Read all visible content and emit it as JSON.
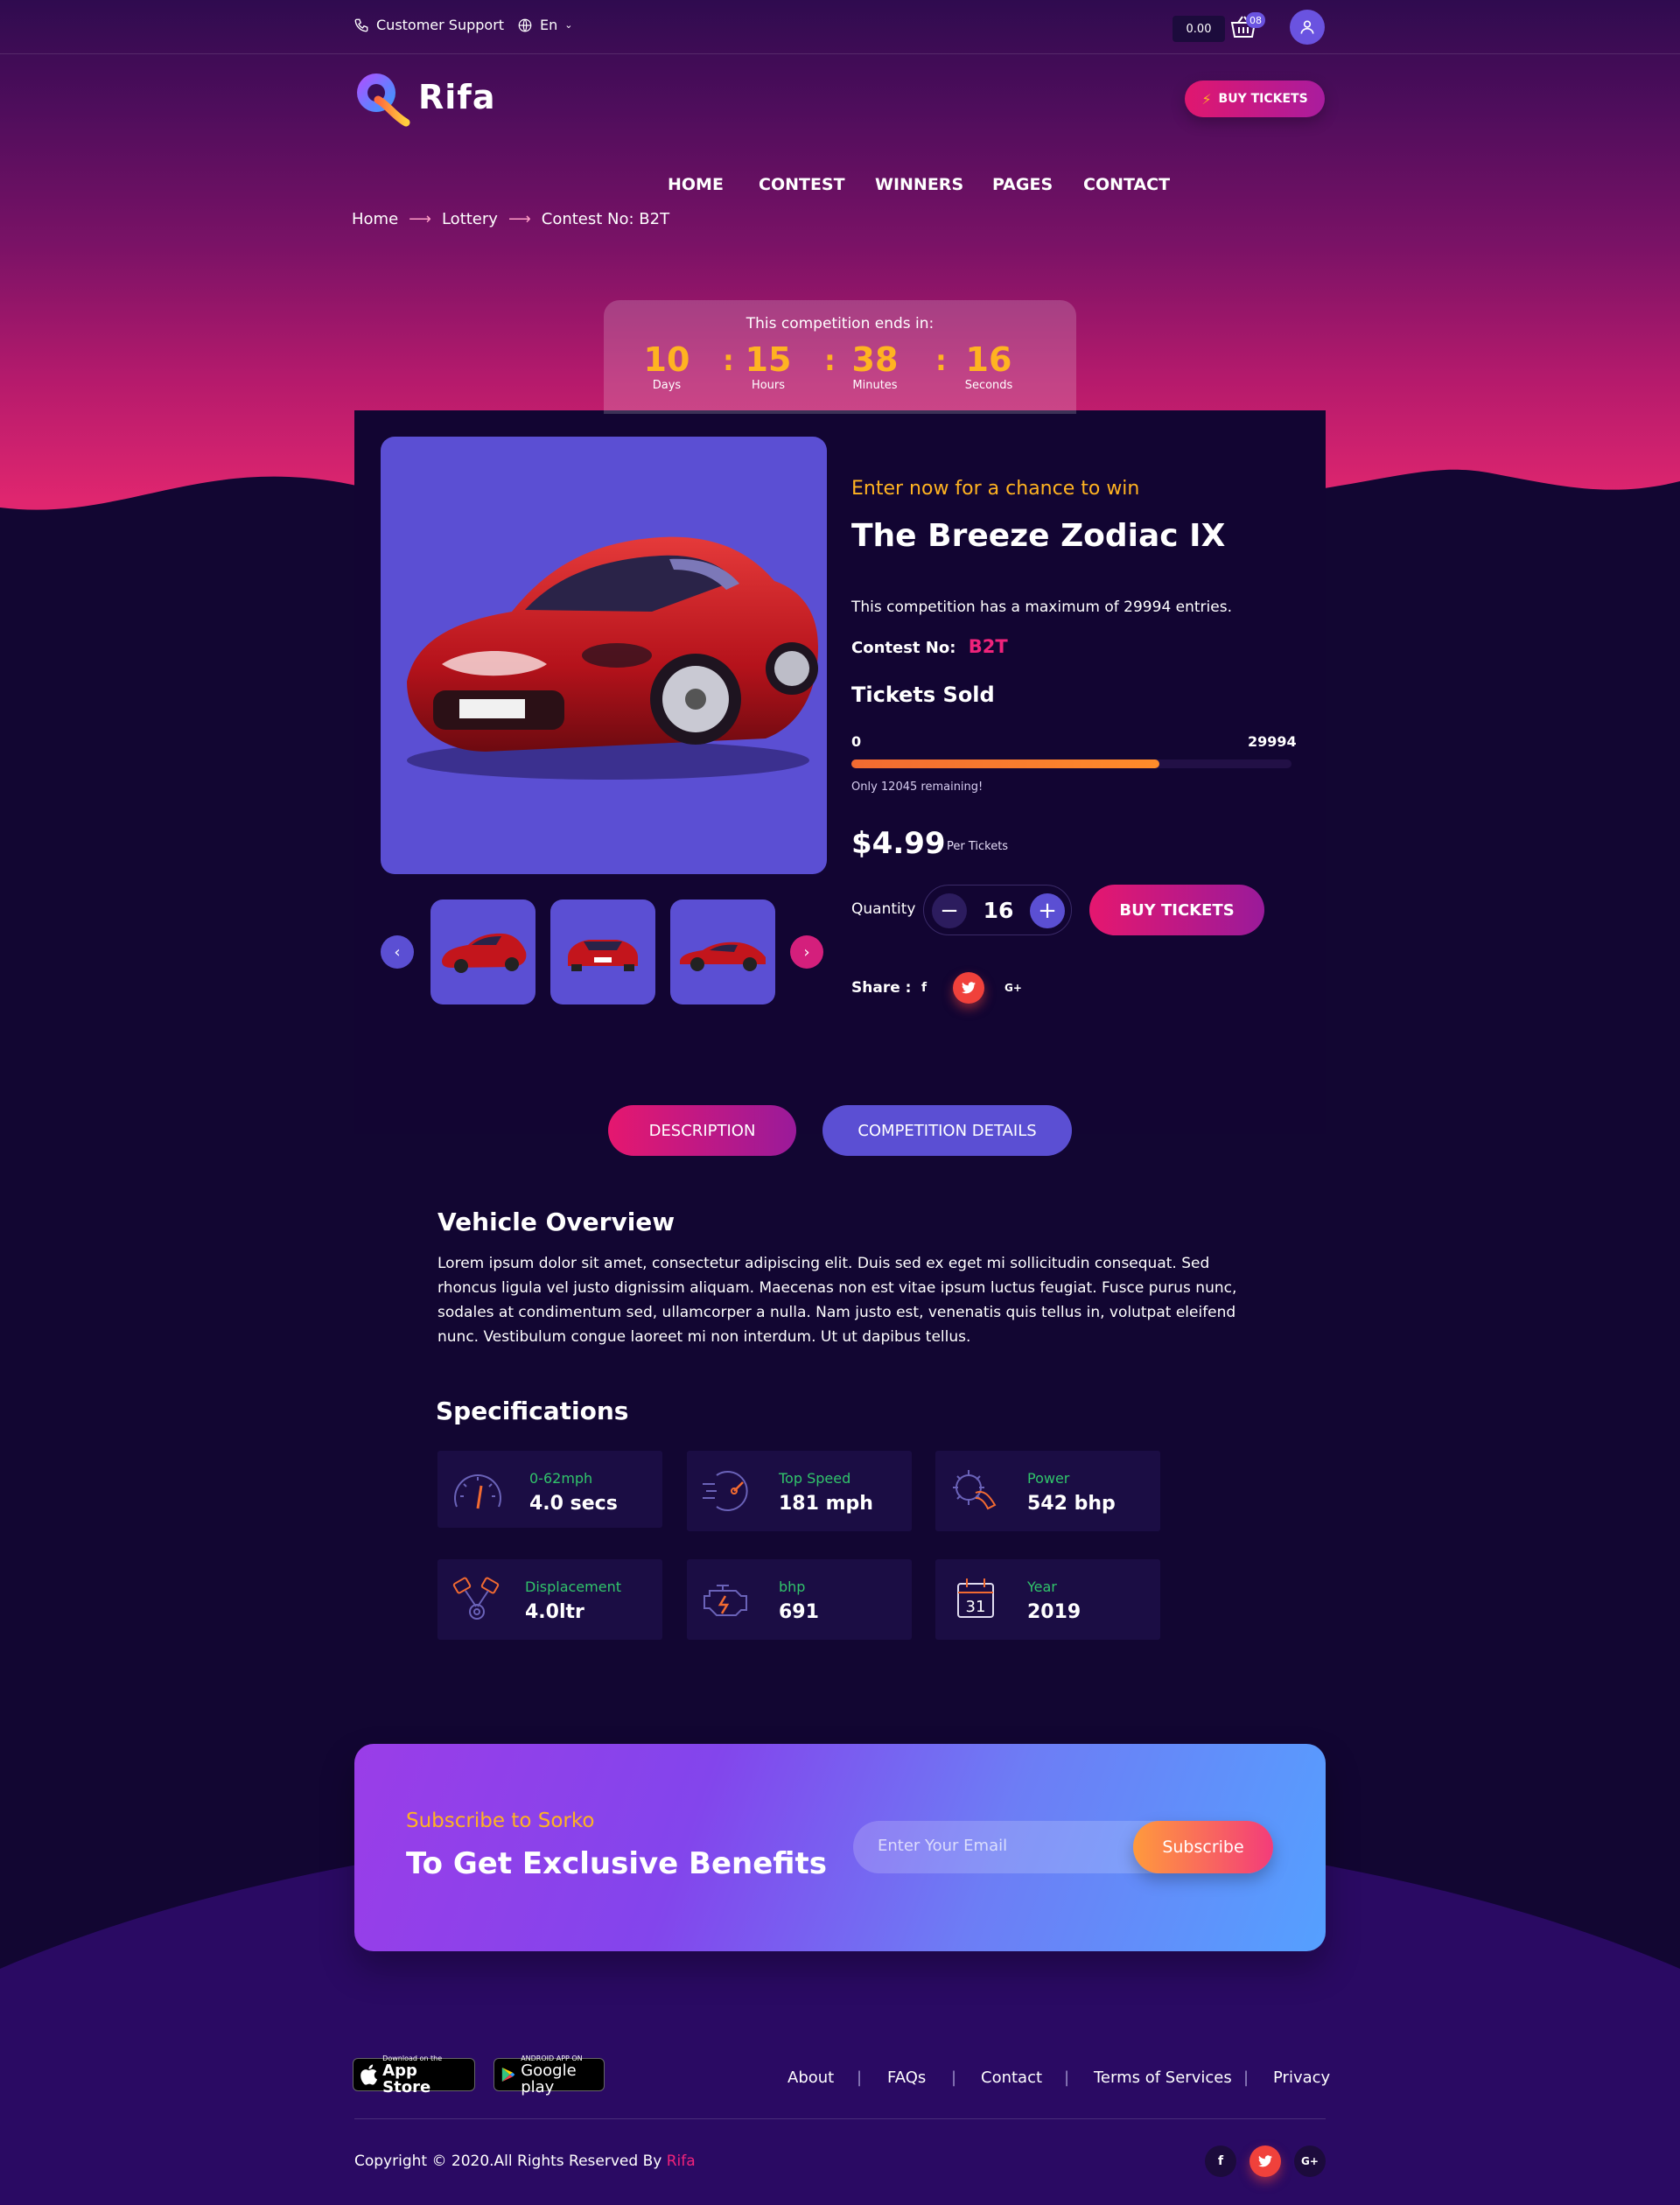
{
  "topbar": {
    "support_label": "Customer Support",
    "language": "En",
    "cart_amount": "0.00",
    "cart_count": "08"
  },
  "brand": {
    "name": "Rifa"
  },
  "nav": {
    "items": [
      "HOME",
      "CONTEST",
      "WINNERS",
      "PAGES",
      "CONTACT"
    ],
    "buy_label": "BUY TICKETS"
  },
  "breadcrumb": [
    "Home",
    "Lottery",
    "Contest No: B2T"
  ],
  "countdown": {
    "title": "This competition ends in:",
    "units": [
      {
        "value": "10",
        "label": "Days"
      },
      {
        "value": "15",
        "label": "Hours"
      },
      {
        "value": "38",
        "label": "Minutes"
      },
      {
        "value": "16",
        "label": "Seconds"
      }
    ]
  },
  "product": {
    "subtitle": "Enter now for a chance to win",
    "title": "The Breeze Zodiac IX",
    "max_entries": "This competition has a maximum of 29994 entries.",
    "contest_label": "Contest No:",
    "contest_value": "B2T",
    "tickets_sold_label": "Tickets Sold",
    "progress_min": "0",
    "progress_max": "29994",
    "progress_fraction": 0.7,
    "remaining": "Only 12045 remaining!",
    "price": "$4.99",
    "price_unit": "Per Tickets",
    "quantity_label": "Quantity",
    "quantity": "16",
    "buy_label": "BUY TICKETS",
    "share_label": "Share :",
    "share_icons": [
      "facebook-icon",
      "twitter-icon",
      "google-plus-icon"
    ]
  },
  "tabs": [
    "DESCRIPTION",
    "COMPETITION DETAILS"
  ],
  "overview": {
    "title": "Vehicle Overview",
    "text": "Lorem ipsum dolor sit amet, consectetur adipiscing elit. Duis sed ex eget mi sollicitudin consequat. Sed rhoncus ligula vel justo dignissim aliquam. Maecenas non est vitae ipsum luctus feugiat. Fusce purus nunc, sodales at condimentum sed, ullamcorper a nulla. Nam justo est, venenatis quis tellus in, volutpat eleifend nunc. Vestibulum congue laoreet mi non interdum. Ut ut dapibus tellus."
  },
  "specs": {
    "title": "Specifications",
    "items": [
      {
        "label": "0-62mph",
        "value": "4.0 secs",
        "icon": "speedometer-icon"
      },
      {
        "label": "Top Speed",
        "value": "181 mph",
        "icon": "speed-gauge-icon"
      },
      {
        "label": "Power",
        "value": "542 bhp",
        "icon": "power-icon"
      },
      {
        "label": "Displacement",
        "value": "4.0ltr",
        "icon": "pistons-icon"
      },
      {
        "label": "bhp",
        "value": "691",
        "icon": "engine-icon"
      },
      {
        "label": "Year",
        "value": "2019",
        "icon": "calendar-icon",
        "icon_text": "31"
      }
    ]
  },
  "subscribe": {
    "kicker": "Subscribe to Sorko",
    "heading": "To Get Exclusive Benefits",
    "placeholder": "Enter Your Email",
    "button": "Subscribe"
  },
  "footer": {
    "app_store": {
      "small": "Download on the",
      "big": "App Store"
    },
    "google_play": {
      "small": "ANDROID APP ON",
      "big": "Google play"
    },
    "links": [
      "About",
      "FAQs",
      "Contact",
      "Terms of Services",
      "Privacy"
    ],
    "copyright": "Copyright © 2020.All Rights Reserved By",
    "copyright_brand": "Rifa"
  },
  "colors": {
    "accent_pink": "#e5176f",
    "accent_orange": "#ffb321",
    "accent_purple": "#5b4fd3",
    "spec_green": "#31c46b",
    "background": "#120532"
  }
}
